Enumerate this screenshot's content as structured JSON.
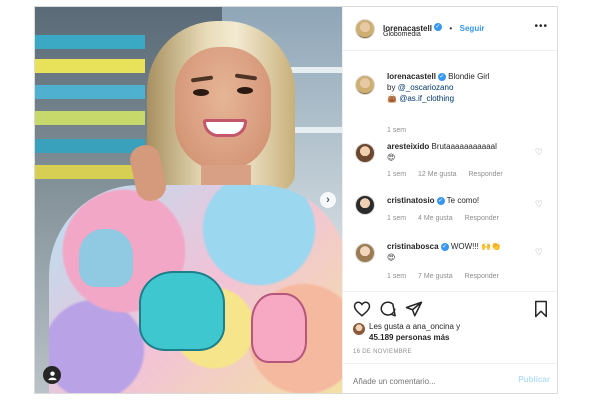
{
  "post": {
    "author": "lorenacastell",
    "follow_label": "Seguir",
    "location": "Globomedia",
    "caption": {
      "text": "Blondie Girl",
      "by_label": "by",
      "mention_1": "@_oscariozano",
      "mention_2": "@as.if_clothing",
      "time": "1 sem"
    },
    "comments": [
      {
        "user": "aresteixido",
        "text": "Brutaaaaaaaaaaal",
        "emoji": "😍",
        "time": "1 sem",
        "likes": "12 Me gusta",
        "reply": "Responder"
      },
      {
        "user": "cristinatosio",
        "text": "Te como!",
        "emoji": "",
        "time": "1 sem",
        "likes": "4 Me gusta",
        "reply": "Responder"
      },
      {
        "user": "cristinabosca",
        "text": "WOW!!!",
        "emoji": "🙌👏",
        "emoji2": "😍",
        "time": "1 sem",
        "likes": "7 Me gusta",
        "reply": "Responder"
      }
    ],
    "likes_line_1": "Les gusta a ana_oncina y",
    "likes_line_2": "45.189 personas más",
    "date": "16 DE NOVIEMBRE",
    "add_comment_placeholder": "Añade un comentario...",
    "publish_label": "Publicar"
  },
  "icons": {
    "verified": "verified-badge-icon",
    "more": "more-options-icon",
    "heart": "heart-icon",
    "comment": "comment-icon",
    "share": "share-icon",
    "bookmark": "bookmark-icon",
    "tag": "user-tag-icon",
    "next": "chevron-right-icon"
  },
  "colors": {
    "accent": "#3897f0",
    "muted": "#8e8e8e",
    "publish_disabled": "#b2dffc"
  }
}
